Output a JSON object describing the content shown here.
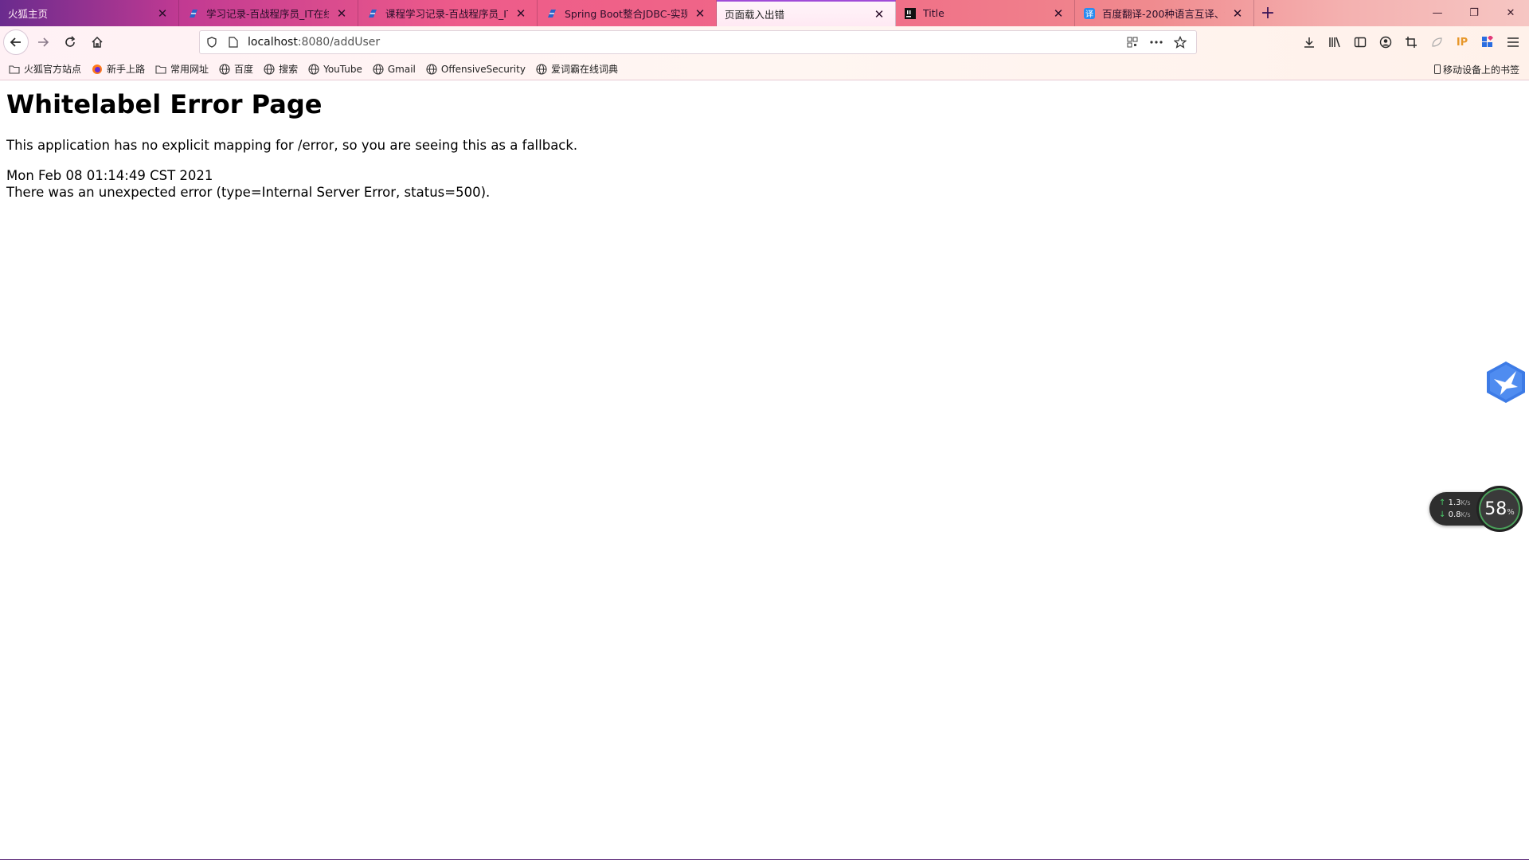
{
  "window": {
    "minimize": "—",
    "restore": "❐",
    "close": "✕"
  },
  "tabs": [
    {
      "title": "火狐主页",
      "icon": "none"
    },
    {
      "title": "学习记录-百战程序员_IT在线教育",
      "icon": "sxt-logo"
    },
    {
      "title": "课程学习记录-百战程序员_IT在线",
      "icon": "sxt-logo"
    },
    {
      "title": "Spring Boot整合JDBC-实现添加",
      "icon": "sxt-logo"
    },
    {
      "title": "页面载入出错",
      "icon": "none"
    },
    {
      "title": "Title",
      "icon": "intellij-logo"
    },
    {
      "title": "百度翻译-200种语言互译、沟通",
      "icon": "baidu-translate-logo"
    }
  ],
  "navbar": {
    "url_host": "localhost",
    "url_path": ":8080/addUser"
  },
  "bookmarks": [
    {
      "label": "火狐官方站点",
      "icon": "folder-icon"
    },
    {
      "label": "新手上路",
      "icon": "firefox-icon"
    },
    {
      "label": "常用网址",
      "icon": "folder-icon"
    },
    {
      "label": "百度",
      "icon": "globe-icon"
    },
    {
      "label": "搜索",
      "icon": "globe-icon"
    },
    {
      "label": "YouTube",
      "icon": "globe-icon"
    },
    {
      "label": "Gmail",
      "icon": "globe-icon"
    },
    {
      "label": "OffensiveSecurity",
      "icon": "globe-icon"
    },
    {
      "label": "爱词霸在线词典",
      "icon": "globe-icon"
    }
  ],
  "bookmarks_mobile": "移动设备上的书签",
  "page": {
    "heading": "Whitelabel Error Page",
    "message": "This application has no explicit mapping for /error, so you are seeing this as a fallback.",
    "timestamp": "Mon Feb 08 01:14:49 CST 2021",
    "error": "There was an unexpected error (type=Internal Server Error, status=500)."
  },
  "net_widget": {
    "upload": "1.3",
    "download": "0.8",
    "unit": "K/s",
    "percent": "58",
    "percent_sign": "%"
  },
  "toolbar_ip_label": "IP",
  "colors": {
    "accent": "#a04cd8",
    "tab_gradient_start": "#6a2b8e",
    "tab_gradient_mid": "#ee5b8a",
    "tab_gradient_end": "#f6c6c3"
  }
}
